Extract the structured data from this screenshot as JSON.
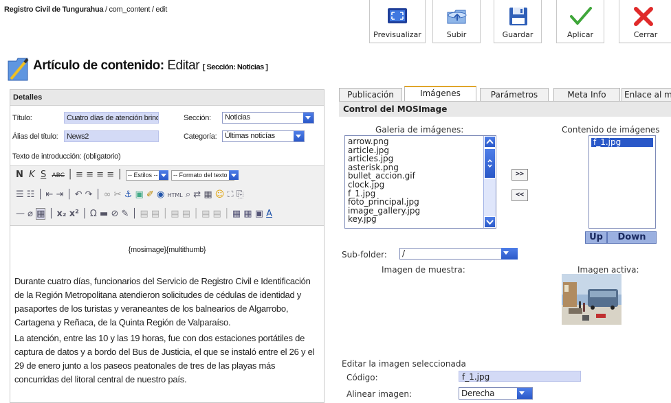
{
  "breadcrumb": {
    "site": "Registro Civil de Tungurahua",
    "path": " / com_content / edit"
  },
  "toolbar": {
    "buttons": [
      "Previsualizar",
      "Subir",
      "Guardar",
      "Aplicar",
      "Cerrar"
    ]
  },
  "page": {
    "title_bold": "Artículo de contenido:",
    "title_action": " Editar",
    "section": "[ Sección: Noticias ]"
  },
  "details": {
    "header": "Detalles",
    "title_label": "Título:",
    "title_value": "Cuatro días de atención brindaran l",
    "section_label": "Sección:",
    "section_value": "Noticias",
    "alias_label": "Álias del título:",
    "alias_value": "News2",
    "category_label": "Categoría:",
    "category_value": "Últimas noticías",
    "intro_label": "Texto de introducción: (obligatorio)"
  },
  "editor": {
    "styles_select": "-- Estilos --",
    "format_select": "-- Formato del texto --",
    "mosimage_tag": "{mosimage}{multithumb}",
    "paragraph1": "Durante cuatro días, funcionarios del Servicio de Registro Civil e Identificación de la Región Metropolitana atendieron solicitudes de cédulas de identidad y pasaportes de los turistas y veraneantes de los balnearios de Algarrobo, Cartagena y Reñaca, de la Quinta Región de Valparaíso.",
    "paragraph2": "La atención, entre las 10 y las 19 horas, fue con dos estaciones portátiles de captura de datos y a bordo del Bus de Justicia, el que se instaló entre el 26 y el 29 de enero junto a los paseos peatonales de tres de las playas más concurridas del litoral central de nuestro país."
  },
  "tabs": [
    "Publicación",
    "Imágenes",
    "Parámetros",
    "Meta Info",
    "Enlace al m"
  ],
  "mosimage": {
    "header": "Control del MOSImage",
    "gallery_label": "Galeria de imágenes:",
    "content_label": "Contenido de imágenes",
    "gallery_items": [
      "arrow.png",
      "article.jpg",
      "articles.jpg",
      "asterisk.png",
      "bullet_accion.gif",
      "clock.jpg",
      "f_1.jpg",
      "foto_principal.jpg",
      "image_gallery.jpg",
      "key.jpg"
    ],
    "content_items": [
      "f_1.jpg"
    ],
    "add_button": ">>",
    "remove_button": "<<",
    "up_button": "Up",
    "down_button": "Down",
    "subfolder_label": "Sub-folder:",
    "subfolder_value": "/",
    "sample_label": "Imagen de muestra:",
    "active_label": "Imagen activa:",
    "edit_label": "Editar la imagen seleccionada",
    "code_label": "Código:",
    "code_value": "f_1.jpg",
    "align_label": "Alinear imagen:",
    "align_value": "Derecha"
  }
}
